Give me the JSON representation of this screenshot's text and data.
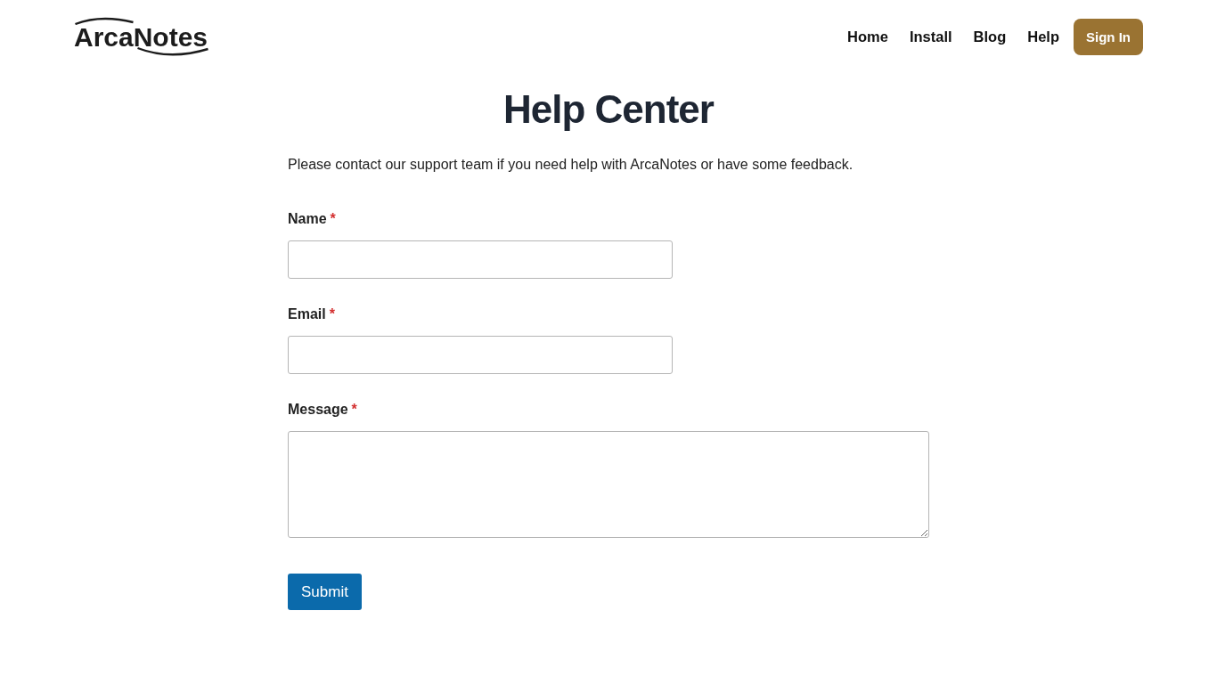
{
  "header": {
    "logo": "ArcaNotes",
    "nav": [
      {
        "label": "Home",
        "kind": "link"
      },
      {
        "label": "Install",
        "kind": "link"
      },
      {
        "label": "Blog",
        "kind": "link"
      },
      {
        "label": "Help",
        "kind": "link"
      },
      {
        "label": "Sign In",
        "kind": "button"
      }
    ]
  },
  "page": {
    "title": "Help Center",
    "intro": "Please contact our support team if you need help with ArcaNotes or have some feedback.",
    "form": {
      "fields": [
        {
          "label": "Name",
          "required_mark": "*",
          "kind": "input"
        },
        {
          "label": "Email",
          "required_mark": "*",
          "kind": "input"
        },
        {
          "label": "Message",
          "required_mark": "*",
          "kind": "textarea"
        }
      ],
      "submit": "Submit"
    }
  }
}
